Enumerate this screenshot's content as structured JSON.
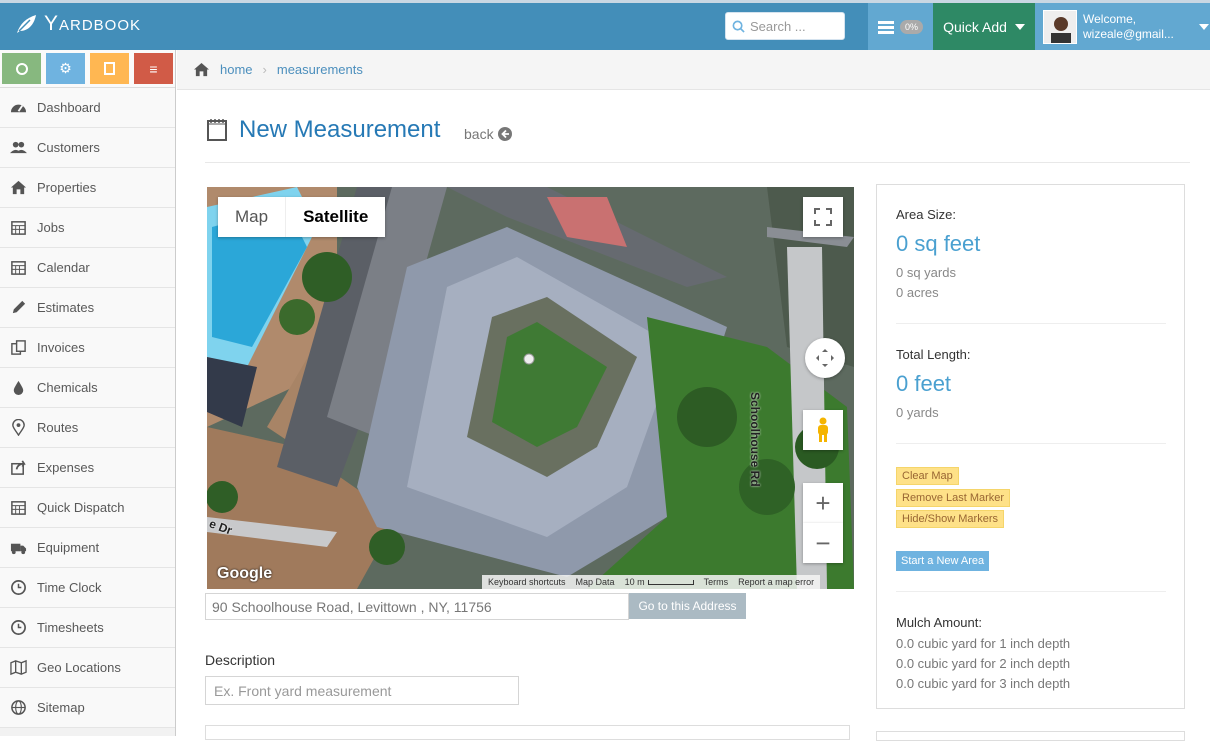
{
  "app": {
    "brand": "Yardbook"
  },
  "topbar": {
    "search_placeholder": "Search ...",
    "progress_badge": "0%",
    "quick_add_label": "Quick Add",
    "user_greeting": "Welcome,",
    "user_email": "wizeale@gmail..."
  },
  "shortcuts": [
    {
      "icon": "globe-icon",
      "color": "#87b87f"
    },
    {
      "icon": "cogs-icon",
      "color": "#6fb3e0"
    },
    {
      "icon": "calculator-icon",
      "color": "#ffb752"
    },
    {
      "icon": "list-icon",
      "color": "#d15b47"
    }
  ],
  "sidebar": {
    "items": [
      {
        "label": "Dashboard",
        "icon": "dashboard-icon"
      },
      {
        "label": "Customers",
        "icon": "users-icon"
      },
      {
        "label": "Properties",
        "icon": "home-icon"
      },
      {
        "label": "Jobs",
        "icon": "calendar-icon"
      },
      {
        "label": "Calendar",
        "icon": "calendar-icon"
      },
      {
        "label": "Estimates",
        "icon": "pencil-icon"
      },
      {
        "label": "Invoices",
        "icon": "invoice-icon"
      },
      {
        "label": "Chemicals",
        "icon": "drop-icon"
      },
      {
        "label": "Routes",
        "icon": "map-marker-icon"
      },
      {
        "label": "Expenses",
        "icon": "share-icon"
      },
      {
        "label": "Quick Dispatch",
        "icon": "calendar-icon"
      },
      {
        "label": "Equipment",
        "icon": "truck-icon"
      },
      {
        "label": "Time Clock",
        "icon": "clock-icon"
      },
      {
        "label": "Timesheets",
        "icon": "clock-icon"
      },
      {
        "label": "Geo Locations",
        "icon": "map-icon"
      },
      {
        "label": "Sitemap",
        "icon": "globe-icon"
      }
    ]
  },
  "breadcrumb": {
    "home": "home",
    "current": "measurements"
  },
  "page": {
    "title": "New Measurement",
    "back": "back"
  },
  "map": {
    "tab_map": "Map",
    "tab_satellite": "Satellite",
    "street_label": "Schoolhouse Rd",
    "street_label2": "e Dr",
    "google": "Google",
    "footer": [
      "Keyboard shortcuts",
      "Map Data",
      "10 m",
      "Terms",
      "Report a map error"
    ]
  },
  "address": {
    "value": "90 Schoolhouse Road, Levittown , NY, 11756",
    "button": "Go to this Address"
  },
  "description": {
    "label": "Description",
    "placeholder": "Ex. Front yard measurement"
  },
  "panel": {
    "area_label": "Area Size:",
    "area_sqft": "0 sq feet",
    "area_sqyd": "0 sq yards",
    "area_acres": "0 acres",
    "length_label": "Total Length:",
    "length_ft": "0 feet",
    "length_yd": "0 yards",
    "clear_map": "Clear Map",
    "remove_last": "Remove Last Marker",
    "hide_show": "Hide/Show Markers",
    "start_new": "Start a New Area",
    "mulch_label": "Mulch Amount:",
    "mulch_1": "0.0 cubic yard for 1 inch depth",
    "mulch_2": "0.0 cubic yard for 2 inch depth",
    "mulch_3": "0.0 cubic yard for 3 inch depth"
  }
}
